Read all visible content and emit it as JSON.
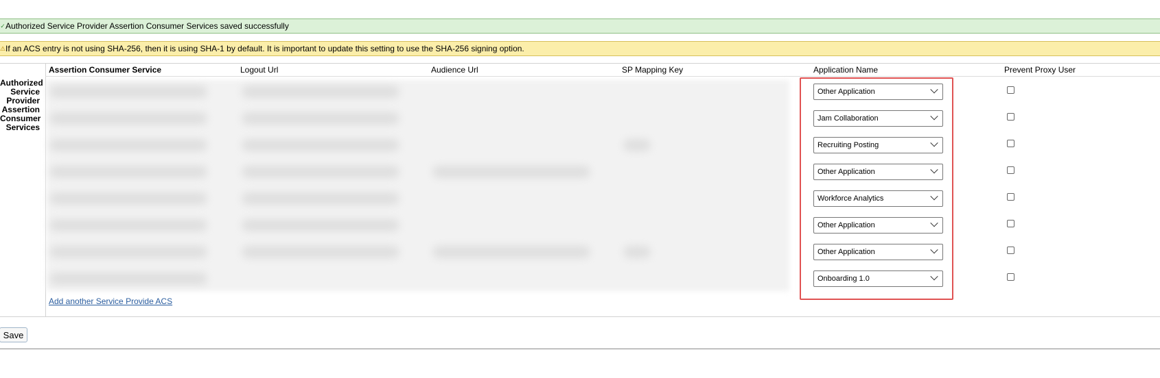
{
  "messages": {
    "success": "Authorized Service Provider Assertion Consumer Services saved successfully",
    "warning": "If an ACS entry is not using SHA-256, then it is using SHA-1 by default. It is important to update this setting to use the SHA-256 signing option."
  },
  "section": {
    "row_label_lines": [
      "Authorized",
      "Service",
      "Provider",
      "Assertion",
      "Consumer",
      "Services"
    ]
  },
  "columns": {
    "acs": "Assertion Consumer Service",
    "logout_url": "Logout Url",
    "audience_url": "Audience Url",
    "sp_mapping_key": "SP Mapping Key",
    "application_name": "Application Name",
    "prevent_proxy_user": "Prevent Proxy User"
  },
  "rows": [
    {
      "application": "Other Application",
      "prevent_proxy": false
    },
    {
      "application": "Jam Collaboration",
      "prevent_proxy": false
    },
    {
      "application": "Recruiting Posting",
      "prevent_proxy": false
    },
    {
      "application": "Other Application",
      "prevent_proxy": false
    },
    {
      "application": "Workforce Analytics",
      "prevent_proxy": false
    },
    {
      "application": "Other Application",
      "prevent_proxy": false
    },
    {
      "application": "Other Application",
      "prevent_proxy": false
    },
    {
      "application": "Onboarding 1.0",
      "prevent_proxy": false
    }
  ],
  "actions": {
    "add_link": "Add another Service Provide ACS",
    "save": "Save"
  },
  "colors": {
    "success_bg": "#dcf1d8",
    "warning_bg": "#fbeeaa",
    "highlight": "#e05252",
    "link": "#2a5d9f"
  }
}
